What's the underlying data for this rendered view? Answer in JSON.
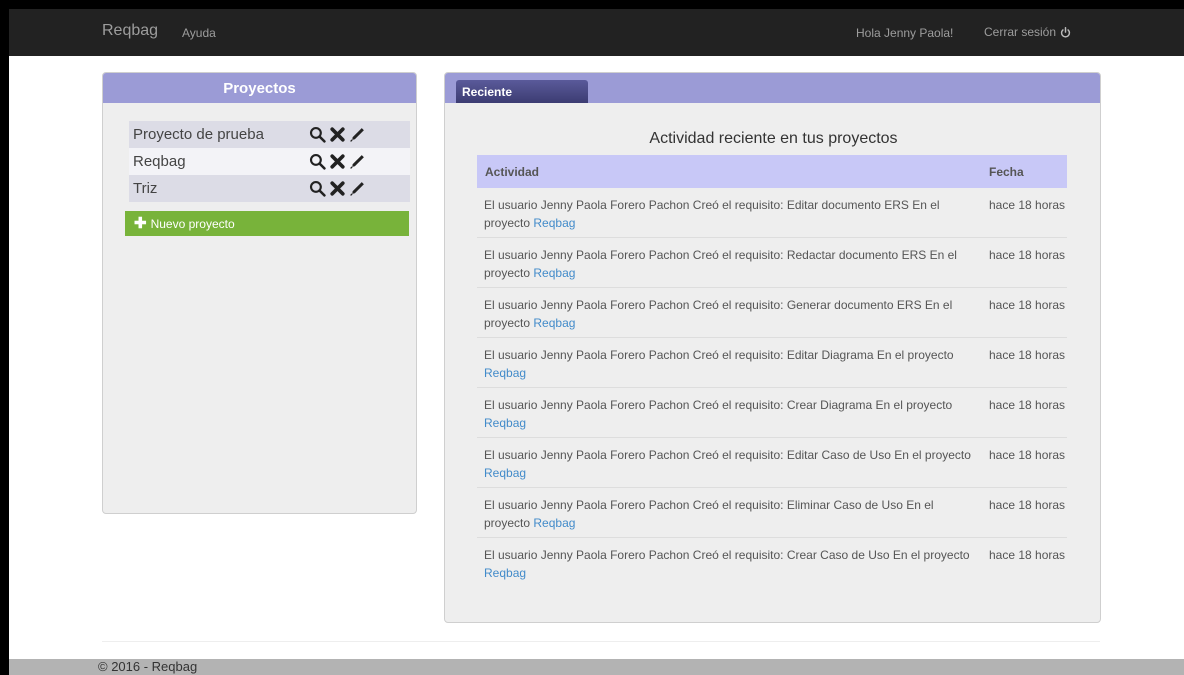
{
  "navbar": {
    "brand": "Reqbag",
    "help": "Ayuda",
    "greeting": "Hola Jenny Paola!",
    "logout": "Cerrar sesión"
  },
  "projects_panel": {
    "title": "Proyectos",
    "items": [
      {
        "name": "Proyecto de prueba"
      },
      {
        "name": "Reqbag"
      },
      {
        "name": "Triz"
      }
    ],
    "new_project_label": "Nuevo proyecto"
  },
  "activity_panel": {
    "tab": "Reciente",
    "title": "Actividad reciente en tus proyectos",
    "col_activity": "Actividad",
    "col_date": "Fecha",
    "rows": [
      {
        "text": "El usuario Jenny Paola Forero Pachon Creó el requisito: Editar documento ERS En el proyecto",
        "project": "Reqbag",
        "date": "hace 18 horas"
      },
      {
        "text": "El usuario Jenny Paola Forero Pachon Creó el requisito: Redactar documento ERS En el proyecto",
        "project": "Reqbag",
        "date": "hace 18 horas"
      },
      {
        "text": "El usuario Jenny Paola Forero Pachon Creó el requisito: Generar documento ERS En el proyecto",
        "project": "Reqbag",
        "date": "hace 18 horas"
      },
      {
        "text": "El usuario Jenny Paola Forero Pachon Creó el requisito: Editar Diagrama En el proyecto",
        "project": "Reqbag",
        "date": "hace 18 horas"
      },
      {
        "text": "El usuario Jenny Paola Forero Pachon Creó el requisito: Crear Diagrama En el proyecto",
        "project": "Reqbag",
        "date": "hace 18 horas"
      },
      {
        "text": "El usuario Jenny Paola Forero Pachon Creó el requisito: Editar Caso de Uso En el proyecto",
        "project": "Reqbag",
        "date": "hace 18 horas"
      },
      {
        "text": "El usuario Jenny Paola Forero Pachon Creó el requisito: Eliminar Caso de Uso En el proyecto",
        "project": "Reqbag",
        "date": "hace 18 horas"
      },
      {
        "text": "El usuario Jenny Paola Forero Pachon Creó el requisito: Crear Caso de Uso En el proyecto",
        "project": "Reqbag",
        "date": "hace 18 horas"
      }
    ]
  },
  "footer": {
    "text": "© 2016 - Reqbag"
  }
}
